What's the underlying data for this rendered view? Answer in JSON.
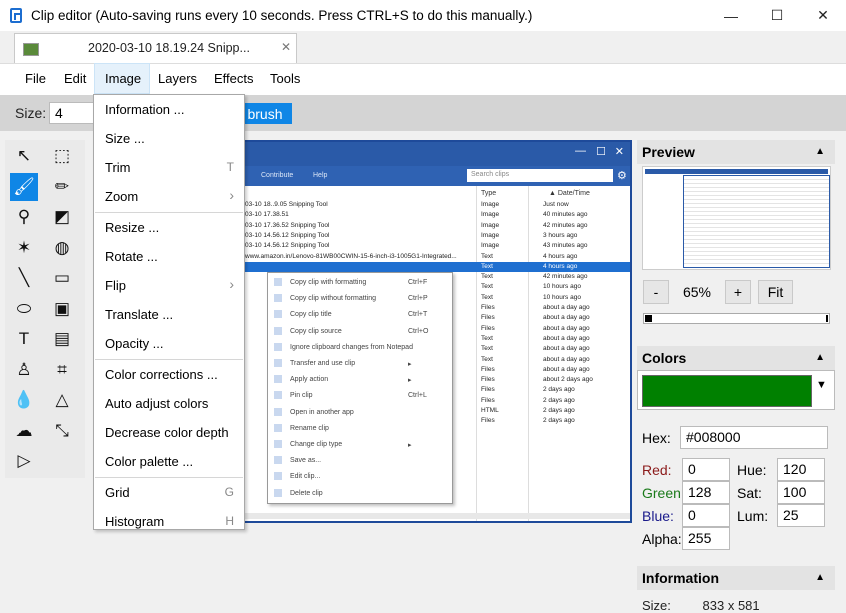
{
  "window": {
    "title": "Clip editor (Auto-saving runs every 10 seconds. Press CTRL+S to do this manually.)",
    "controls": {
      "minimize": "—",
      "maximize": "☐",
      "close": "✕"
    }
  },
  "tab": {
    "label": "2020-03-10 18.19.24 Snipp...",
    "close": "✕"
  },
  "menubar": {
    "items": [
      "File",
      "Edit",
      "Image",
      "Layers",
      "Effects",
      "Tools"
    ],
    "active": "Image"
  },
  "toolbar": {
    "size_label": "Size:",
    "size_value": "4",
    "brush_label": "brush"
  },
  "image_menu": {
    "items": [
      {
        "label": "Information ...",
        "shortcut": ""
      },
      {
        "label": "Size ...",
        "shortcut": ""
      },
      {
        "label": "Trim",
        "shortcut": "T"
      },
      {
        "label": "Zoom",
        "shortcut": "",
        "submenu": true
      },
      {
        "label": "Resize ...",
        "shortcut": ""
      },
      {
        "label": "Rotate ...",
        "shortcut": ""
      },
      {
        "label": "Flip",
        "shortcut": "",
        "submenu": true
      },
      {
        "label": "Translate ...",
        "shortcut": ""
      },
      {
        "label": "Opacity ...",
        "shortcut": ""
      },
      {
        "label": "Color corrections ...",
        "shortcut": ""
      },
      {
        "label": "Auto adjust colors",
        "shortcut": ""
      },
      {
        "label": "Decrease color depth",
        "shortcut": ""
      },
      {
        "label": "Color palette ...",
        "shortcut": ""
      },
      {
        "label": "Grid",
        "shortcut": "G"
      },
      {
        "label": "Histogram",
        "shortcut": "H"
      }
    ]
  },
  "tools": [
    {
      "icon": "pointer-icon",
      "glyph": "↖",
      "selected": false
    },
    {
      "icon": "marquee-select-icon",
      "glyph": "⬚",
      "selected": false
    },
    {
      "icon": "paint-brush-icon",
      "glyph": "🖌",
      "selected": true
    },
    {
      "icon": "pencil-icon",
      "glyph": "✏",
      "selected": false
    },
    {
      "icon": "eyedropper-icon",
      "glyph": "⚲",
      "selected": false
    },
    {
      "icon": "eraser-icon",
      "glyph": "◩",
      "selected": false
    },
    {
      "icon": "magic-wand-icon",
      "glyph": "✶",
      "selected": false
    },
    {
      "icon": "fill-bucket-icon",
      "glyph": "◍",
      "selected": false
    },
    {
      "icon": "line-icon",
      "glyph": "╲",
      "selected": false
    },
    {
      "icon": "rectangle-icon",
      "glyph": "▭",
      "selected": false
    },
    {
      "icon": "ellipse-icon",
      "glyph": "⬭",
      "selected": false
    },
    {
      "icon": "image-icon",
      "glyph": "▣",
      "selected": false
    },
    {
      "icon": "text-icon",
      "glyph": "T",
      "selected": false
    },
    {
      "icon": "gradient-icon",
      "glyph": "▤",
      "selected": false
    },
    {
      "icon": "stamp-icon",
      "glyph": "♙",
      "selected": false
    },
    {
      "icon": "crop-icon",
      "glyph": "⌗",
      "selected": false
    },
    {
      "icon": "blur-drop-icon",
      "glyph": "💧",
      "selected": false
    },
    {
      "icon": "triangle-icon",
      "glyph": "△",
      "selected": false
    },
    {
      "icon": "sponge-icon",
      "glyph": "☁",
      "selected": false
    },
    {
      "icon": "shrink-icon",
      "glyph": "⤡",
      "selected": false
    },
    {
      "icon": "play-icon",
      "glyph": "▷",
      "selected": false
    }
  ],
  "preview": {
    "title": "Preview",
    "zoom": "65%",
    "minus": "-",
    "plus": "+",
    "fit": "Fit"
  },
  "colors": {
    "title": "Colors",
    "swatch": "#008000",
    "hex_label": "Hex:",
    "hex": "#008000",
    "red_label": "Red:",
    "red": "0",
    "green_label": "Green",
    "green": "128",
    "blue_label": "Blue:",
    "blue": "0",
    "alpha_label": "Alpha:",
    "alpha": "255",
    "hue_label": "Hue:",
    "hue": "120",
    "sat_label": "Sat:",
    "sat": "100",
    "lum_label": "Lum:",
    "lum": "25"
  },
  "information": {
    "title": "Information",
    "size_label": "Size:",
    "size_value": "833 x 581"
  },
  "embedded": {
    "nav": [
      "Contribute",
      "Help"
    ],
    "search_placeholder": "Search clips",
    "col_type": "Type",
    "col_date": "▲ Date/Time",
    "rows": [
      {
        "name": "03-10 18..9.05 Snipping Tool",
        "type": "Image",
        "date": "Just now"
      },
      {
        "name": "03-10 17.38.51",
        "type": "Image",
        "date": "40 minutes ago"
      },
      {
        "name": "03-10 17.36.52 Snipping Tool",
        "type": "Image",
        "date": "42 minutes ago"
      },
      {
        "name": "03-10 14.56.12 Snipping Tool",
        "type": "Image",
        "date": "3 hours ago"
      },
      {
        "name": "03-10 14.56.12 Snipping Tool",
        "type": "Image",
        "date": "43 minutes ago"
      },
      {
        "name": "www.amazon.in/Lenovo-81WB00CWIN-15-6-inch-i3-1005G1-Integrated...",
        "type": "Text",
        "date": "4 hours ago"
      },
      {
        "name": "",
        "type": "Text",
        "date": "4 hours ago"
      },
      {
        "name": "",
        "type": "Text",
        "date": "42 minutes ago"
      },
      {
        "name": "",
        "type": "Text",
        "date": "10 hours ago"
      },
      {
        "name": "",
        "type": "Text",
        "date": "10 hours ago"
      },
      {
        "name": "",
        "type": "Files",
        "date": "about a day ago"
      },
      {
        "name": "",
        "type": "Files",
        "date": "about a day ago"
      },
      {
        "name": "",
        "type": "Files",
        "date": "about a day ago"
      },
      {
        "name": "",
        "type": "Text",
        "date": "about a day ago"
      },
      {
        "name": "",
        "type": "Text",
        "date": "about a day ago"
      },
      {
        "name": "",
        "type": "Text",
        "date": "about a day ago"
      },
      {
        "name": "",
        "type": "Files",
        "date": "about a day ago"
      },
      {
        "name": "",
        "type": "Files",
        "date": "about 2 days ago"
      },
      {
        "name": "",
        "type": "Files",
        "date": "2 days ago"
      },
      {
        "name": "",
        "type": "Files",
        "date": "2 days ago"
      },
      {
        "name": "",
        "type": "HTML",
        "date": "2 days ago"
      },
      {
        "name": "",
        "type": "Files",
        "date": "2 days ago"
      }
    ],
    "context_menu": [
      {
        "label": "Copy clip with formatting",
        "key": "Ctrl+F"
      },
      {
        "label": "Copy clip without formatting",
        "key": "Ctrl+P"
      },
      {
        "label": "Copy clip title",
        "key": "Ctrl+T"
      },
      {
        "label": "Copy clip source",
        "key": "Ctrl+O"
      },
      {
        "label": "Ignore clipboard changes from Notepad",
        "key": ""
      },
      {
        "label": "Transfer and use clip",
        "key": "▸"
      },
      {
        "label": "Apply action",
        "key": "▸"
      },
      {
        "label": "Pin clip",
        "key": "Ctrl+L"
      },
      {
        "label": "Open in another app",
        "key": ""
      },
      {
        "label": "Rename clip",
        "key": ""
      },
      {
        "label": "Change clip type",
        "key": "▸"
      },
      {
        "label": "Save as...",
        "key": ""
      },
      {
        "label": "Edit clip...",
        "key": ""
      },
      {
        "label": "Delete clip",
        "key": ""
      }
    ]
  }
}
